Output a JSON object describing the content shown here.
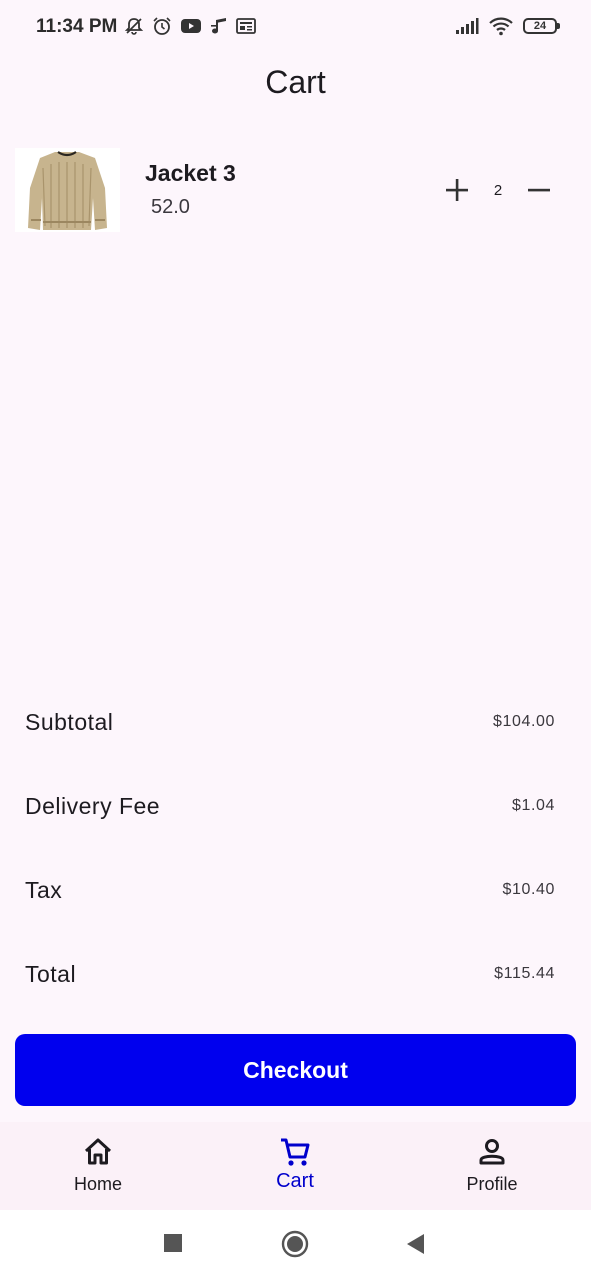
{
  "status_bar": {
    "time": "11:34 PM",
    "battery_level": "24",
    "left_icons": [
      "mute-icon",
      "alarm-icon",
      "youtube-icon",
      "music-icon",
      "news-icon"
    ],
    "right_icons": [
      "signal-icon",
      "wifi-icon",
      "battery-icon"
    ]
  },
  "page": {
    "title": "Cart"
  },
  "cart": {
    "items": [
      {
        "name": "Jacket 3",
        "price": "52.0",
        "quantity": "2",
        "image": "sweater-image"
      }
    ]
  },
  "summary": {
    "subtotal": {
      "label": "Subtotal",
      "value": "$104.00"
    },
    "delivery_fee": {
      "label": "Delivery Fee",
      "value": "$1.04"
    },
    "tax": {
      "label": "Tax",
      "value": "$10.40"
    },
    "total": {
      "label": "Total",
      "value": "$115.44"
    }
  },
  "checkout": {
    "label": "Checkout"
  },
  "bottom_nav": {
    "items": [
      {
        "label": "Home",
        "icon": "home-icon",
        "active": false
      },
      {
        "label": "Cart",
        "icon": "cart-icon",
        "active": true
      },
      {
        "label": "Profile",
        "icon": "person-icon",
        "active": false
      }
    ]
  },
  "colors": {
    "background": "#fdf6fc",
    "primary": "#0000ee",
    "active_nav": "#0000cc",
    "nav_background": "#fbf1f8"
  }
}
